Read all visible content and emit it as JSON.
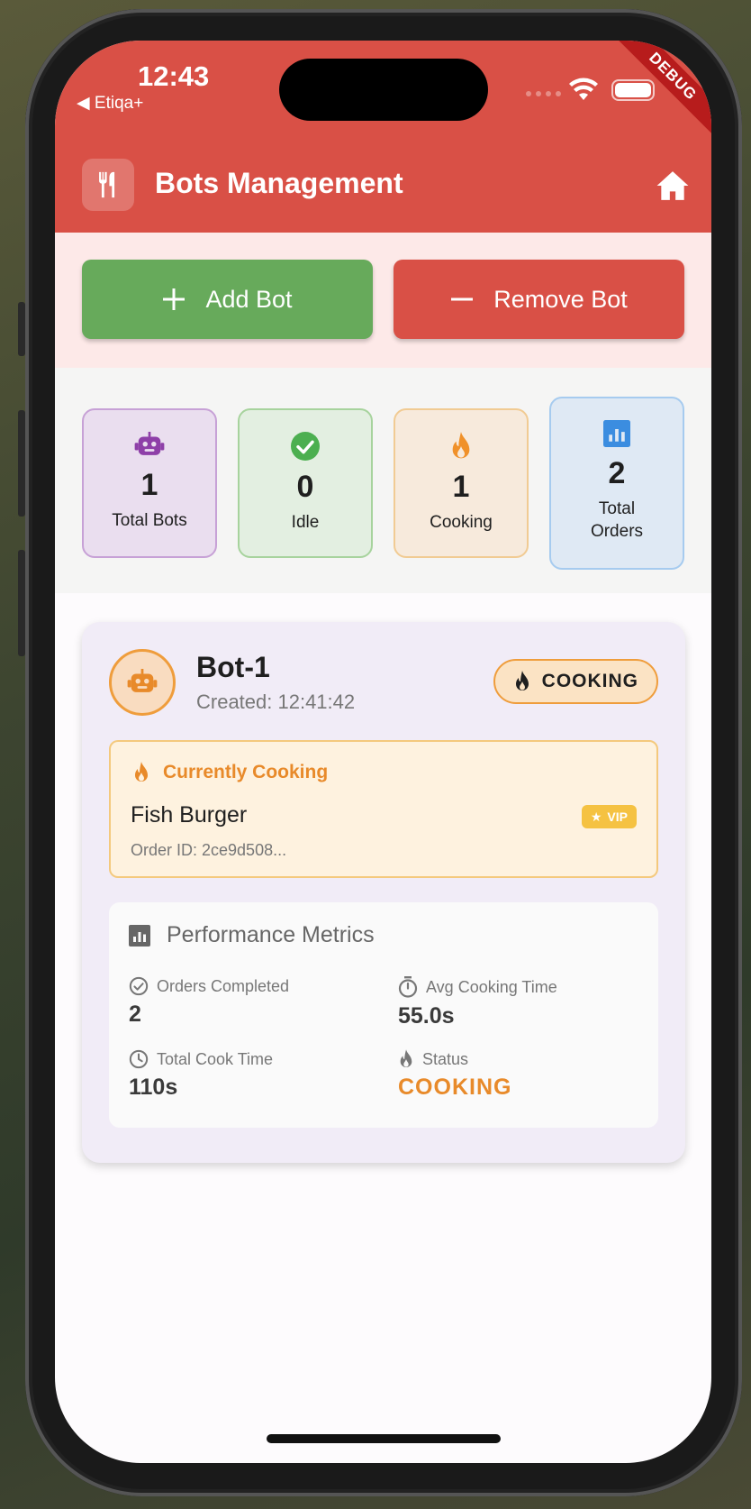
{
  "status_bar": {
    "time": "12:43",
    "back_app": "◀ Etiqa+"
  },
  "debug_banner": "DEBUG",
  "app_bar": {
    "title": "Bots Management"
  },
  "actions": {
    "add_label": "Add Bot",
    "remove_label": "Remove Bot"
  },
  "stats": [
    {
      "icon": "robot-icon",
      "value": "1",
      "label": "Total Bots",
      "color": "#8e3fa8"
    },
    {
      "icon": "check-circle-icon",
      "value": "0",
      "label": "Idle",
      "color": "#4caf50"
    },
    {
      "icon": "fire-icon",
      "value": "1",
      "label": "Cooking",
      "color": "#f0912a"
    },
    {
      "icon": "bar-chart-icon",
      "value": "2",
      "label": "Total\nOrders",
      "color": "#3b8de0"
    }
  ],
  "bot": {
    "name": "Bot-1",
    "created": "Created: 12:41:42",
    "status": "COOKING",
    "current": {
      "heading": "Currently Cooking",
      "item": "Fish Burger",
      "order_id": "Order ID: 2ce9d508...",
      "badge": "VIP"
    },
    "metrics": {
      "heading": "Performance Metrics",
      "orders_completed_label": "Orders Completed",
      "orders_completed": "2",
      "avg_time_label": "Avg Cooking Time",
      "avg_time": "55.0s",
      "total_time_label": "Total Cook Time",
      "total_time": "110s",
      "status_label": "Status",
      "status": "COOKING"
    }
  },
  "colors": {
    "primary": "#d95046",
    "add": "#67aa5b",
    "cooking": "#e88a2a"
  }
}
